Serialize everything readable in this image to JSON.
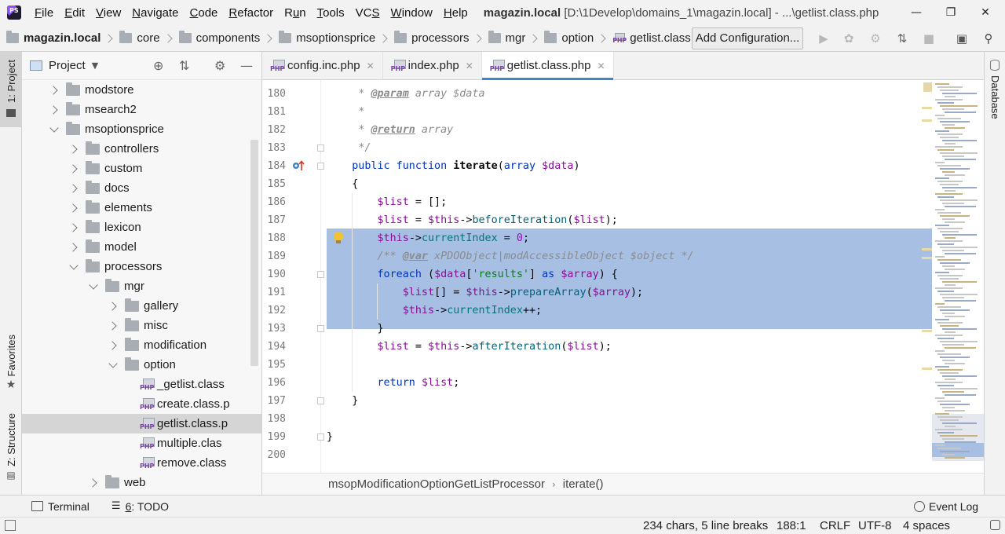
{
  "menu": {
    "items": [
      "File",
      "Edit",
      "View",
      "Navigate",
      "Code",
      "Refactor",
      "Run",
      "Tools",
      "VCS",
      "Window",
      "Help"
    ],
    "underlines": [
      "F",
      "E",
      "V",
      "N",
      "C",
      "R",
      "u",
      "T",
      "S",
      "W",
      "H"
    ],
    "title_project": "magazin.local",
    "title_rest": "[D:\\1Develop\\domains_1\\magazin.local] - ...\\getlist.class.php",
    "window_buttons": [
      "minimize",
      "maximize",
      "close"
    ]
  },
  "navbar": {
    "crumbs": [
      "magazin.local",
      "core",
      "components",
      "msoptionsprice",
      "processors",
      "mgr",
      "option",
      "getlist.class.php"
    ],
    "add_configuration": "Add Configuration...",
    "tool_icons": [
      "run-icon",
      "debug-icon",
      "coverage-icon",
      "profile-icon",
      "stop-icon",
      "terminal-window-icon",
      "search-icon"
    ]
  },
  "left_tabs": {
    "project": "1: Project",
    "favorites": "Favorites",
    "structure": "Z: Structure"
  },
  "right_tabs": {
    "database": "Database"
  },
  "project_panel": {
    "title": "Project",
    "tree": [
      {
        "label": "modstore",
        "depth": 0,
        "type": "folder",
        "state": "closed"
      },
      {
        "label": "msearch2",
        "depth": 0,
        "type": "folder",
        "state": "closed"
      },
      {
        "label": "msoptionsprice",
        "depth": 0,
        "type": "folder",
        "state": "open"
      },
      {
        "label": "controllers",
        "depth": 1,
        "type": "folder",
        "state": "closed"
      },
      {
        "label": "custom",
        "depth": 1,
        "type": "folder",
        "state": "closed"
      },
      {
        "label": "docs",
        "depth": 1,
        "type": "folder",
        "state": "closed"
      },
      {
        "label": "elements",
        "depth": 1,
        "type": "folder",
        "state": "closed"
      },
      {
        "label": "lexicon",
        "depth": 1,
        "type": "folder",
        "state": "closed"
      },
      {
        "label": "model",
        "depth": 1,
        "type": "folder",
        "state": "closed"
      },
      {
        "label": "processors",
        "depth": 1,
        "type": "folder",
        "state": "open"
      },
      {
        "label": "mgr",
        "depth": 2,
        "type": "folder",
        "state": "open"
      },
      {
        "label": "gallery",
        "depth": 3,
        "type": "folder",
        "state": "closed"
      },
      {
        "label": "misc",
        "depth": 3,
        "type": "folder",
        "state": "closed"
      },
      {
        "label": "modification",
        "depth": 3,
        "type": "folder",
        "state": "closed"
      },
      {
        "label": "option",
        "depth": 3,
        "type": "folder",
        "state": "open"
      },
      {
        "label": "_getlist.class",
        "depth": 4,
        "type": "php"
      },
      {
        "label": "create.class.p",
        "depth": 4,
        "type": "php"
      },
      {
        "label": "getlist.class.p",
        "depth": 4,
        "type": "php",
        "selected": true
      },
      {
        "label": "multiple.clas",
        "depth": 4,
        "type": "php"
      },
      {
        "label": "remove.class",
        "depth": 4,
        "type": "php"
      },
      {
        "label": "web",
        "depth": 2,
        "type": "folder",
        "state": "closed"
      }
    ]
  },
  "editor_tabs": [
    {
      "label": "config.inc.php",
      "active": false
    },
    {
      "label": "index.php",
      "active": false
    },
    {
      "label": "getlist.class.php",
      "active": true
    }
  ],
  "editor": {
    "lines": [
      {
        "n": "180",
        "html": "     <span class=\"cmt\">* <span class=\"tag\">@param</span> array $data</span>"
      },
      {
        "n": "181",
        "html": "     <span class=\"cmt\">*</span>"
      },
      {
        "n": "182",
        "html": "     <span class=\"cmt\">* <span class=\"tag\">@return</span> array</span>"
      },
      {
        "n": "183",
        "html": "     <span class=\"cmt\">*/</span>"
      },
      {
        "n": "184",
        "html": "    <span class=\"kw\">public function</span> <b>iterate</b>(<span class=\"kw\">array</span> <span class=\"var\">$data</span>)"
      },
      {
        "n": "185",
        "html": "    {"
      },
      {
        "n": "186",
        "html": "        <span class=\"var\">$list</span> = [];"
      },
      {
        "n": "187",
        "html": "        <span class=\"var\">$list</span> = <span class=\"var\">$this</span>-><span class=\"fn\">beforeIteration</span>(<span class=\"var\">$list</span>);"
      },
      {
        "n": "188",
        "html": "        <span class=\"var\">$this</span>-><span class=\"fld\">currentIndex</span> = <span class=\"num\">0</span>;"
      },
      {
        "n": "189",
        "html": "        <span class=\"cmt\">/** <span class=\"tag\">@var</span> xPDOObject|modAccessibleObject $object */</span>"
      },
      {
        "n": "190",
        "html": "        <span class=\"kw\">foreach</span> (<span class=\"var\">$data</span>[<span class=\"str\">'results'</span>] <span class=\"kw\">as</span> <span class=\"var\">$array</span>) {"
      },
      {
        "n": "191",
        "html": "            <span class=\"var\">$list</span>[] = <span class=\"var\">$this</span>-><span class=\"fn\">prepareArray</span>(<span class=\"var\">$array</span>);"
      },
      {
        "n": "192",
        "html": "            <span class=\"var\">$this</span>-><span class=\"fld\">currentIndex</span>++;"
      },
      {
        "n": "193",
        "html": "        }"
      },
      {
        "n": "194",
        "html": "        <span class=\"var\">$list</span> = <span class=\"var\">$this</span>-><span class=\"fn\">afterIteration</span>(<span class=\"var\">$list</span>);"
      },
      {
        "n": "195",
        "html": ""
      },
      {
        "n": "196",
        "html": "        <span class=\"kw\">return</span> <span class=\"var\">$list</span>;"
      },
      {
        "n": "197",
        "html": "    }"
      },
      {
        "n": "198",
        "html": ""
      },
      {
        "n": "199",
        "html": "}"
      },
      {
        "n": "200",
        "html": ""
      }
    ],
    "selection_lines": [
      188,
      189,
      190,
      191,
      192,
      193
    ],
    "cursor_line": 188
  },
  "code_crumbs": [
    "msopModificationOptionGetListProcessor",
    "iterate()"
  ],
  "bottom_tools": {
    "terminal": "Terminal",
    "todo": "6: TODO",
    "event_log": "Event Log"
  },
  "status": {
    "selection_info": "234 chars, 5 line breaks",
    "position": "188:1",
    "line_sep": "CRLF",
    "encoding": "UTF-8",
    "indent": "4 spaces"
  },
  "colors": {
    "accent": "#4083c9",
    "selection": "#a6bfe3",
    "keyword": "#0033b3",
    "variable": "#871094"
  }
}
